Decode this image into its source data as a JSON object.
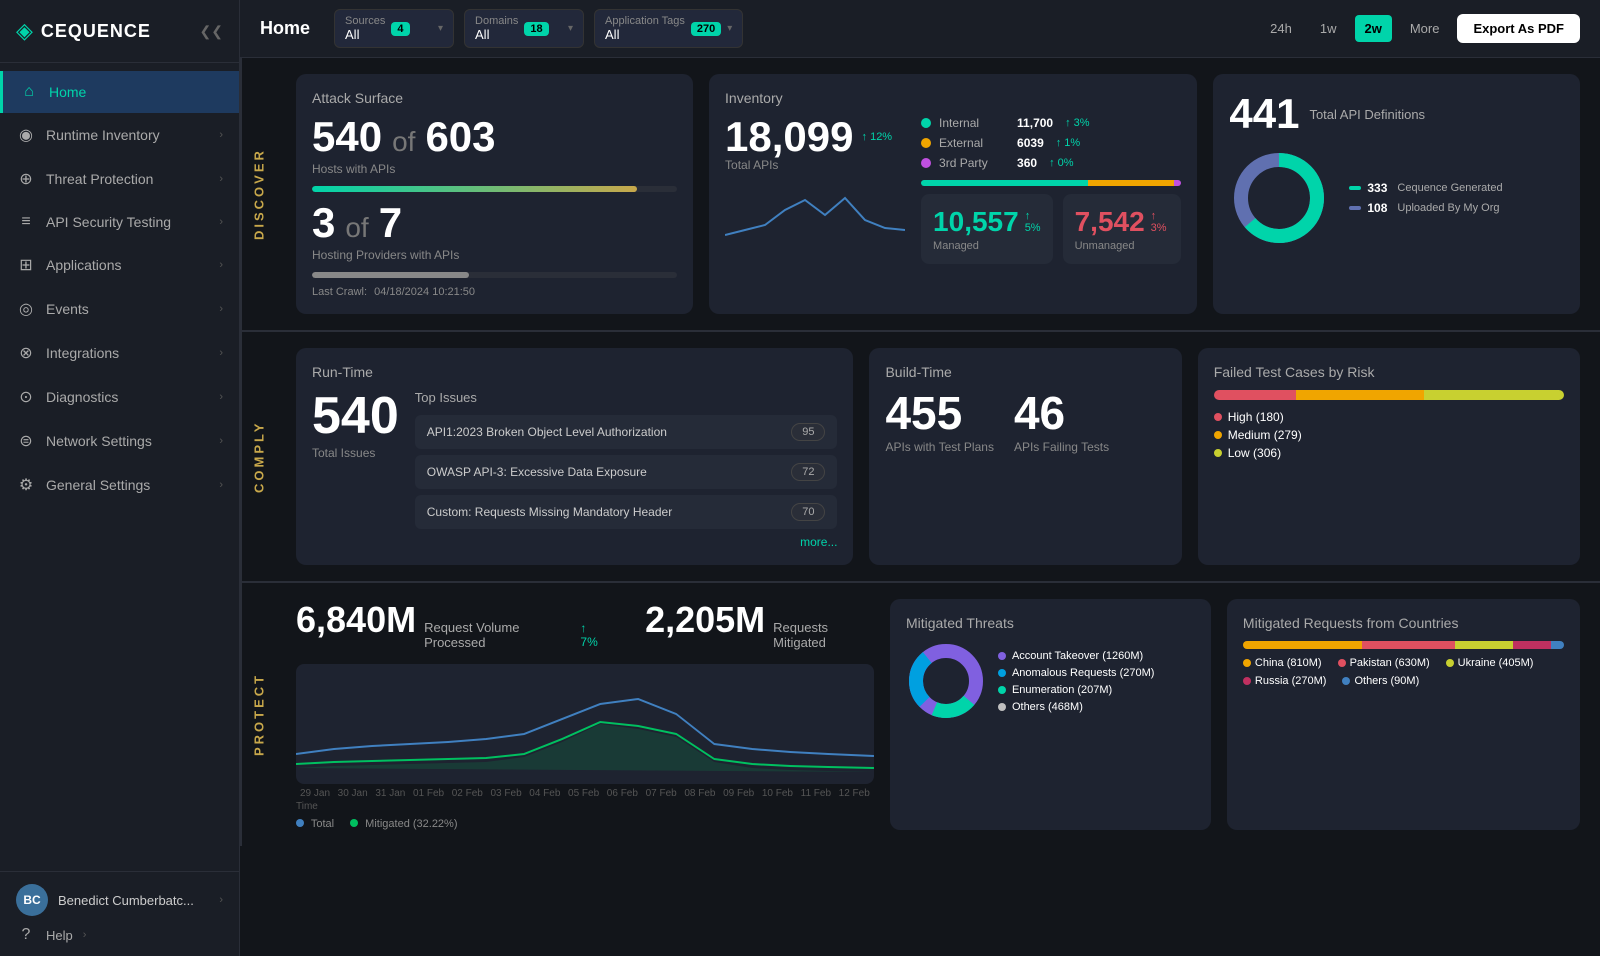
{
  "app": {
    "logo": "CEQUENCE",
    "logo_icon": "◈"
  },
  "sidebar": {
    "items": [
      {
        "id": "home",
        "label": "Home",
        "icon": "⌂",
        "active": true
      },
      {
        "id": "runtime-inventory",
        "label": "Runtime Inventory",
        "icon": "◉",
        "active": false
      },
      {
        "id": "threat-protection",
        "label": "Threat Protection",
        "icon": "⊕",
        "active": false
      },
      {
        "id": "api-security-testing",
        "label": "API Security Testing",
        "icon": "≡",
        "active": false
      },
      {
        "id": "applications",
        "label": "Applications",
        "icon": "⊞",
        "active": false
      },
      {
        "id": "events",
        "label": "Events",
        "icon": "◎",
        "active": false
      },
      {
        "id": "integrations",
        "label": "Integrations",
        "icon": "⊗",
        "active": false
      },
      {
        "id": "diagnostics",
        "label": "Diagnostics",
        "icon": "⊙",
        "active": false
      },
      {
        "id": "network-settings",
        "label": "Network Settings",
        "icon": "⊜",
        "active": false
      },
      {
        "id": "general-settings",
        "label": "General Settings",
        "icon": "⚙",
        "active": false
      }
    ],
    "user": {
      "initials": "BC",
      "name": "Benedict Cumberbatc..."
    },
    "help_label": "Help"
  },
  "topbar": {
    "page_title": "Home",
    "filters": {
      "sources": {
        "label": "Sources",
        "value": "All",
        "badge": "4"
      },
      "domains": {
        "label": "Domains",
        "value": "All",
        "badge": "18"
      },
      "app_tags": {
        "label": "Application Tags",
        "value": "All",
        "badge": "270"
      }
    },
    "time_buttons": [
      {
        "label": "24h",
        "active": false
      },
      {
        "label": "1w",
        "active": false
      },
      {
        "label": "2w",
        "active": true
      },
      {
        "label": "More",
        "active": false
      }
    ],
    "export_label": "Export As PDF"
  },
  "discover": {
    "section_label": "Discover",
    "attack_surface": {
      "title": "Attack Surface",
      "hosts_num": "540",
      "hosts_of": "of",
      "hosts_total": "603",
      "hosts_label": "Hosts with APIs",
      "providers_num": "3",
      "providers_of": "of",
      "providers_total": "7",
      "providers_label": "Hosting Providers with APIs",
      "crawl_label": "Last Crawl:",
      "crawl_date": "04/18/2024 10:21:50",
      "hosts_progress": 89,
      "providers_progress": 43
    },
    "inventory": {
      "title": "Inventory",
      "total": "18,099",
      "total_label": "Total APIs",
      "trend": "↑ 12%",
      "internal": {
        "label": "Internal",
        "value": "11,700",
        "trend": "↑ 3%",
        "color": "#00d4aa"
      },
      "external": {
        "label": "External",
        "value": "6039",
        "trend": "↑ 1%",
        "color": "#f0a500"
      },
      "third_party": {
        "label": "3rd Party",
        "value": "360",
        "trend": "↑ 0%",
        "color": "#c050e0"
      },
      "managed": {
        "value": "10,557",
        "label": "Managed",
        "trend": "↑ 5%"
      },
      "unmanaged": {
        "value": "7,542",
        "label": "Unmanaged",
        "trend": "↑ 3%"
      }
    },
    "api_definitions": {
      "title": "Total API Definitions",
      "total": "441",
      "cequence_generated": "333",
      "cequence_label": "Cequence Generated",
      "uploaded": "108",
      "uploaded_label": "Uploaded By My Org",
      "donut_color1": "#00d4aa",
      "donut_color2": "#6070b0"
    }
  },
  "comply": {
    "section_label": "Comply",
    "runtime": {
      "title": "Run-Time",
      "total_issues": "540",
      "total_label": "Total Issues",
      "top_issues_title": "Top Issues",
      "issues": [
        {
          "label": "API1:2023 Broken Object Level Authorization",
          "count": "95"
        },
        {
          "label": "OWASP API-3: Excessive Data Exposure",
          "count": "72"
        },
        {
          "label": "Custom: Requests Missing Mandatory Header",
          "count": "70"
        }
      ],
      "more_link": "more..."
    },
    "buildtime": {
      "title": "Build-Time",
      "apis_with_test_plans": "455",
      "apis_label": "APIs with Test Plans",
      "apis_failing": "46",
      "failing_label": "APIs Failing Tests"
    },
    "failed_tests": {
      "title": "Failed Test Cases by Risk",
      "high": {
        "label": "High (180)",
        "value": 180,
        "color": "#e05060"
      },
      "medium": {
        "label": "Medium (279)",
        "value": 279,
        "color": "#f0a500"
      },
      "low": {
        "label": "Low (306)",
        "value": 306,
        "color": "#c8d030"
      }
    }
  },
  "protect": {
    "section_label": "Protect",
    "request_volume": "6,840M",
    "request_label": "Request Volume Processed",
    "request_trend": "↑ 7%",
    "requests_mitigated": "2,205M",
    "mitigated_label": "Requests Mitigated",
    "chart_legend": [
      {
        "label": "Total",
        "color": "#4080c0"
      },
      {
        "label": "Mitigated (32.22%)",
        "color": "#00c060"
      }
    ],
    "mitigated_threats": {
      "title": "Mitigated Threats",
      "items": [
        {
          "label": "Account Takeover (1260M)",
          "color": "#8060e0"
        },
        {
          "label": "Anomalous Requests (270M)",
          "color": "#00a0e0"
        },
        {
          "label": "Enumeration (207M)",
          "color": "#00d4aa"
        },
        {
          "label": "Others (468M)",
          "color": "#c0c0c0"
        }
      ]
    },
    "mitigated_countries": {
      "title": "Mitigated Requests from Countries",
      "bars": [
        {
          "label": "China (810M)",
          "color": "#f0a500",
          "pct": 37
        },
        {
          "label": "Pakistan (630M)",
          "color": "#e05060",
          "pct": 29
        },
        {
          "label": "Ukraine (405M)",
          "color": "#8060e0",
          "pct": 18
        },
        {
          "label": "Russia (270M)",
          "color": "#c03060",
          "pct": 12
        },
        {
          "label": "Others (90M)",
          "color": "#4080c0",
          "pct": 4
        }
      ]
    },
    "chart_x_labels": [
      "29 Jan",
      "30 Jan",
      "31 Jan",
      "01 Feb",
      "02 Feb",
      "03 Feb",
      "04 Feb",
      "05 Feb",
      "06 Feb",
      "07 Feb",
      "08 Feb",
      "09 Feb",
      "10 Feb",
      "11 Feb",
      "12 Feb"
    ]
  }
}
